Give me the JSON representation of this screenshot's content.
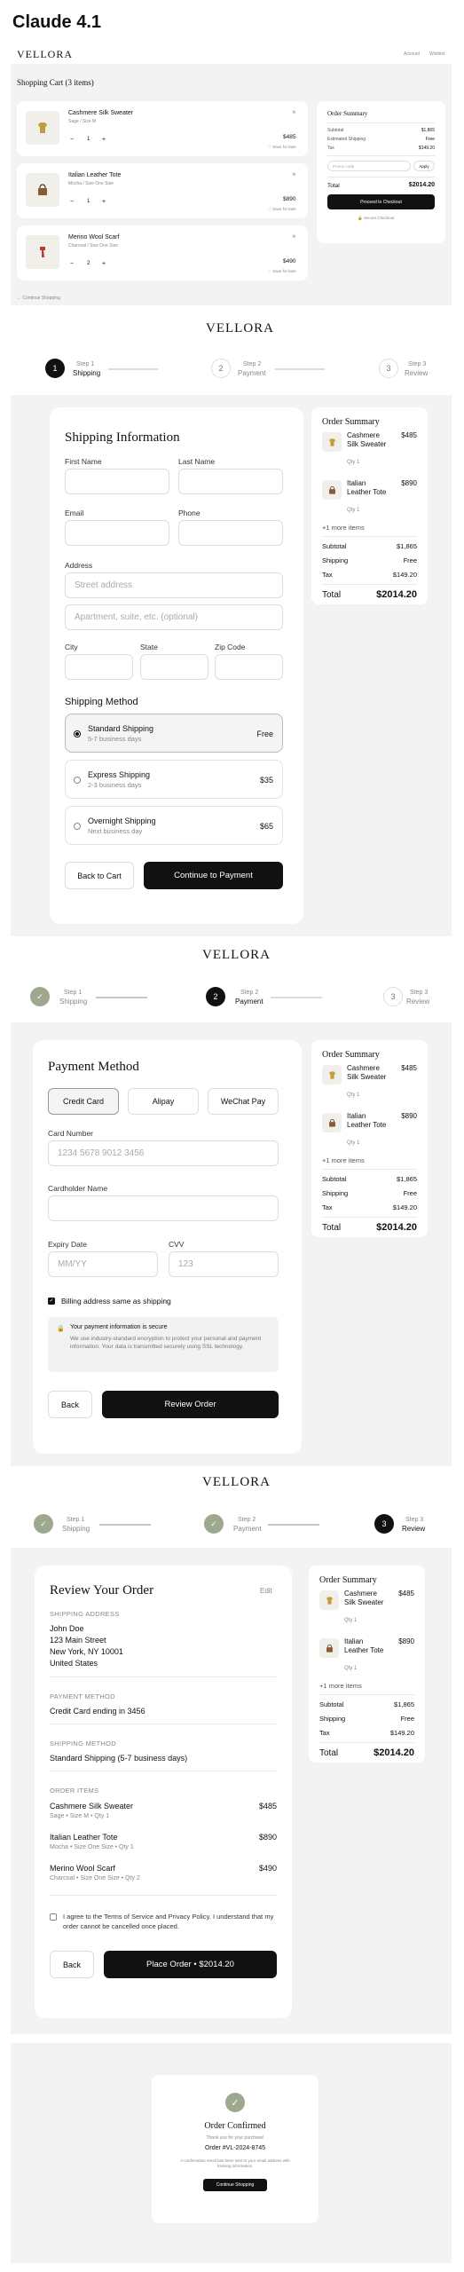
{
  "page_title": "Claude 4.1",
  "brand": "VELLORA",
  "header_links": {
    "account": "Account",
    "wishlist": "Wishlist"
  },
  "cart": {
    "title": "Shopping Cart (3 items)",
    "items": [
      {
        "name": "Cashmere Silk Sweater",
        "variant": "Sage / Size M",
        "qty": "1",
        "price": "$485",
        "save": "♡ Save for later",
        "remove": "×"
      },
      {
        "name": "Italian Leather Tote",
        "variant": "Mocha / Size One Size",
        "qty": "1",
        "price": "$890",
        "save": "♡ Save for later",
        "remove": "×"
      },
      {
        "name": "Merino Wool Scarf",
        "variant": "Charcoal / Size One Size",
        "qty": "2",
        "price": "$490",
        "save": "♡ Save for later",
        "remove": "×"
      }
    ],
    "continue": "← Continue Shopping",
    "summary": {
      "title": "Order Summary",
      "subtotal_label": "Subtotal",
      "subtotal": "$1,865",
      "shipping_label": "Estimated Shipping",
      "shipping": "Free",
      "tax_label": "Tax",
      "tax": "$149.20",
      "promo_placeholder": "Promo code",
      "apply": "Apply",
      "total_label": "Total",
      "total": "$2014.20",
      "checkout": "Proceed to Checkout",
      "secure": "🔒 Secure Checkout"
    }
  },
  "steps": [
    {
      "label": "Step 1",
      "name": "Shipping",
      "num": "1"
    },
    {
      "label": "Step 2",
      "name": "Payment",
      "num": "2"
    },
    {
      "label": "Step 3",
      "name": "Review",
      "num": "3"
    }
  ],
  "summary_panel": {
    "title": "Order Summary",
    "items": [
      {
        "name": "Cashmere Silk Sweater",
        "qty": "Qty 1",
        "price": "$485"
      },
      {
        "name": "Italian Leather Tote",
        "qty": "Qty 1",
        "price": "$890"
      }
    ],
    "more": "+1 more items",
    "subtotal_label": "Subtotal",
    "subtotal": "$1,865",
    "shipping_label": "Shipping",
    "shipping": "Free",
    "tax_label": "Tax",
    "tax": "$149.20",
    "total_label": "Total",
    "total": "$2014.20"
  },
  "shipping": {
    "title": "Shipping Information",
    "first_name": "First Name",
    "last_name": "Last Name",
    "email": "Email",
    "phone": "Phone",
    "address": "Address",
    "street_placeholder": "Street address",
    "apt_placeholder": "Apartment, suite, etc. (optional)",
    "city": "City",
    "state": "State",
    "zip": "Zip Code",
    "method_title": "Shipping Method",
    "methods": [
      {
        "name": "Standard Shipping",
        "time": "5-7 business days",
        "price": "Free"
      },
      {
        "name": "Express Shipping",
        "time": "2-3 business days",
        "price": "$35"
      },
      {
        "name": "Overnight Shipping",
        "time": "Next business day",
        "price": "$65"
      }
    ],
    "back": "Back to Cart",
    "continue": "Continue to Payment"
  },
  "payment": {
    "title": "Payment Method",
    "tabs": [
      "Credit Card",
      "Alipay",
      "WeChat Pay"
    ],
    "card_number": "Card Number",
    "card_placeholder": "1234 5678 9012 3456",
    "cardholder": "Cardholder Name",
    "expiry": "Expiry Date",
    "expiry_placeholder": "MM/YY",
    "cvv": "CVV",
    "cvv_placeholder": "123",
    "billing_same": "Billing address same as shipping",
    "secure_title": "Your payment information is secure",
    "secure_text": "We use industry-standard encryption to protect your personal and payment information. Your data is transmitted securely using SSL technology.",
    "back": "Back",
    "review": "Review Order"
  },
  "review": {
    "title": "Review Your Order",
    "edit": "Edit",
    "ship_addr_label": "SHIPPING ADDRESS",
    "address_lines": [
      "John Doe",
      "123 Main Street",
      "New York, NY 10001",
      "United States"
    ],
    "pay_label": "PAYMENT METHOD",
    "pay_value": "Credit Card ending in 3456",
    "ship_method_label": "SHIPPING METHOD",
    "ship_method_value": "Standard Shipping (5-7 business days)",
    "items_label": "ORDER ITEMS",
    "items": [
      {
        "name": "Cashmere Silk Sweater",
        "detail": "Sage • Size M • Qty 1",
        "price": "$485"
      },
      {
        "name": "Italian Leather Tote",
        "detail": "Mocha • Size One Size • Qty 1",
        "price": "$890"
      },
      {
        "name": "Merino Wool Scarf",
        "detail": "Charcoal • Size One Size • Qty 2",
        "price": "$490"
      }
    ],
    "terms": "I agree to the Terms of Service and Privacy Policy. I understand that my order cannot be cancelled once placed.",
    "back": "Back",
    "place": "Place Order • $2014.20"
  },
  "confirm": {
    "title": "Order Confirmed",
    "thanks": "Thank you for your purchase!",
    "order_no": "Order #VL-2024-8745",
    "email_note": "A confirmation email has been sent to your email address with tracking information.",
    "continue": "Continue Shopping"
  },
  "colors": {
    "accent": "#111111",
    "success": "#9ea88e",
    "panel_bg": "#f3f3f3"
  }
}
